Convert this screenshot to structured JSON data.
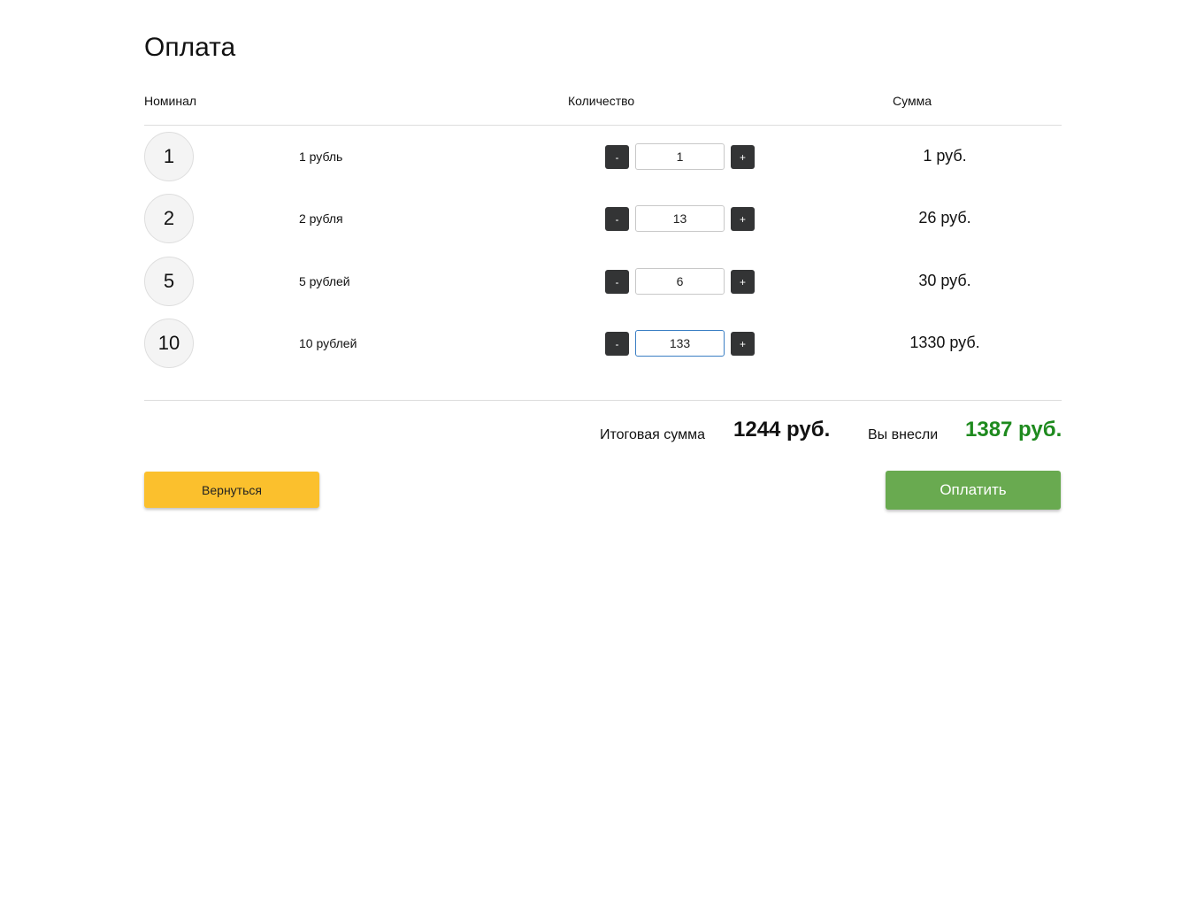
{
  "page": {
    "title": "Оплата"
  },
  "table": {
    "headers": {
      "nominal": "Номинал",
      "quantity": "Количество",
      "sum": "Сумма"
    },
    "rows": [
      {
        "coin": "1",
        "label": "1 рубль",
        "minus": "-",
        "plus": "+",
        "quantity": "1",
        "sum": "1 руб."
      },
      {
        "coin": "2",
        "label": "2 рубля",
        "minus": "-",
        "plus": "+",
        "quantity": "13",
        "sum": "26 руб."
      },
      {
        "coin": "5",
        "label": "5 рублей",
        "minus": "-",
        "plus": "+",
        "quantity": "6",
        "sum": "30 руб."
      },
      {
        "coin": "10",
        "label": "10 рублей",
        "minus": "-",
        "plus": "+",
        "quantity": "133",
        "sum": "1330 руб."
      }
    ]
  },
  "summary": {
    "total_label": "Итоговая сумма",
    "total_value": "1244 руб.",
    "paid_label": "Вы внесли",
    "paid_value": "1387 руб."
  },
  "actions": {
    "back_label": "Вернуться",
    "pay_label": "Оплатить"
  },
  "colors": {
    "back_button": "#fbc02d",
    "pay_button": "#69aa50",
    "paid_value": "#1e8a1e",
    "stepper_button": "#333435",
    "focused_input_border": "#3b7fc4"
  }
}
